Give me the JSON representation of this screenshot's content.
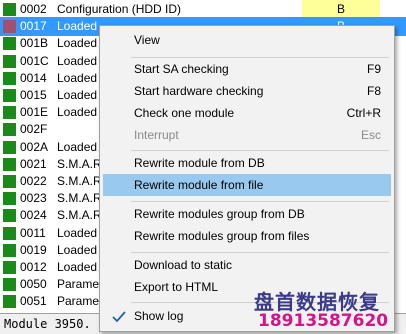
{
  "modules": [
    {
      "id": "0002",
      "name": "Configuration (HDD ID)",
      "flag": "B",
      "selected": false
    },
    {
      "id": "0017",
      "name": "Loaded",
      "flag": "B",
      "selected": true
    },
    {
      "id": "001B",
      "name": "Loaded",
      "flag": "",
      "selected": false
    },
    {
      "id": "001C",
      "name": "Loaded",
      "flag": "",
      "selected": false
    },
    {
      "id": "0014",
      "name": "Loaded",
      "flag": "",
      "selected": false
    },
    {
      "id": "0015",
      "name": "Loaded",
      "flag": "",
      "selected": false
    },
    {
      "id": "001E",
      "name": "Loaded",
      "flag": "",
      "selected": false
    },
    {
      "id": "002F",
      "name": "",
      "flag": "",
      "selected": false
    },
    {
      "id": "002A",
      "name": "Loaded",
      "flag": "",
      "selected": false
    },
    {
      "id": "0021",
      "name": "S.M.A.R",
      "flag": "",
      "selected": false
    },
    {
      "id": "0022",
      "name": "S.M.A.R",
      "flag": "",
      "selected": false
    },
    {
      "id": "0023",
      "name": "S.M.A.R",
      "flag": "",
      "selected": false
    },
    {
      "id": "0024",
      "name": "S.M.A.R",
      "flag": "",
      "selected": false
    },
    {
      "id": "0011",
      "name": "Loaded",
      "flag": "",
      "selected": false
    },
    {
      "id": "0019",
      "name": "Loaded",
      "flag": "",
      "selected": false
    },
    {
      "id": "0012",
      "name": "Loaded",
      "flag": "",
      "selected": false
    },
    {
      "id": "0050",
      "name": "Paramet",
      "flag": "",
      "selected": false
    },
    {
      "id": "0051",
      "name": "Paramet",
      "flag": "",
      "selected": false
    }
  ],
  "status_text": "Module 3950.",
  "menu": {
    "view": "View",
    "start_sa": "Start SA checking",
    "start_sa_sc": "F9",
    "start_hw": "Start hardware checking",
    "start_hw_sc": "F8",
    "check_one": "Check one module",
    "check_one_sc": "Ctrl+R",
    "interrupt": "Interrupt",
    "interrupt_sc": "Esc",
    "rewrite_db": "Rewrite module from DB",
    "rewrite_file": "Rewrite module from file",
    "rewrite_group_db": "Rewrite modules group from DB",
    "rewrite_group_files": "Rewrite modules group from files",
    "download_static": "Download to static",
    "export_html": "Export to HTML",
    "show_log": "Show log"
  },
  "watermark": {
    "line1": "盘首数据恢复",
    "line2": "18913587620"
  },
  "colors": {
    "module_ok": "#1a8a1a",
    "selection": "#3399ff",
    "menu_highlight": "#99c9ef",
    "flag_bg": "#ffff99"
  },
  "icons": {
    "status_square": "green-square-icon",
    "checkmark": "checkmark-icon"
  }
}
